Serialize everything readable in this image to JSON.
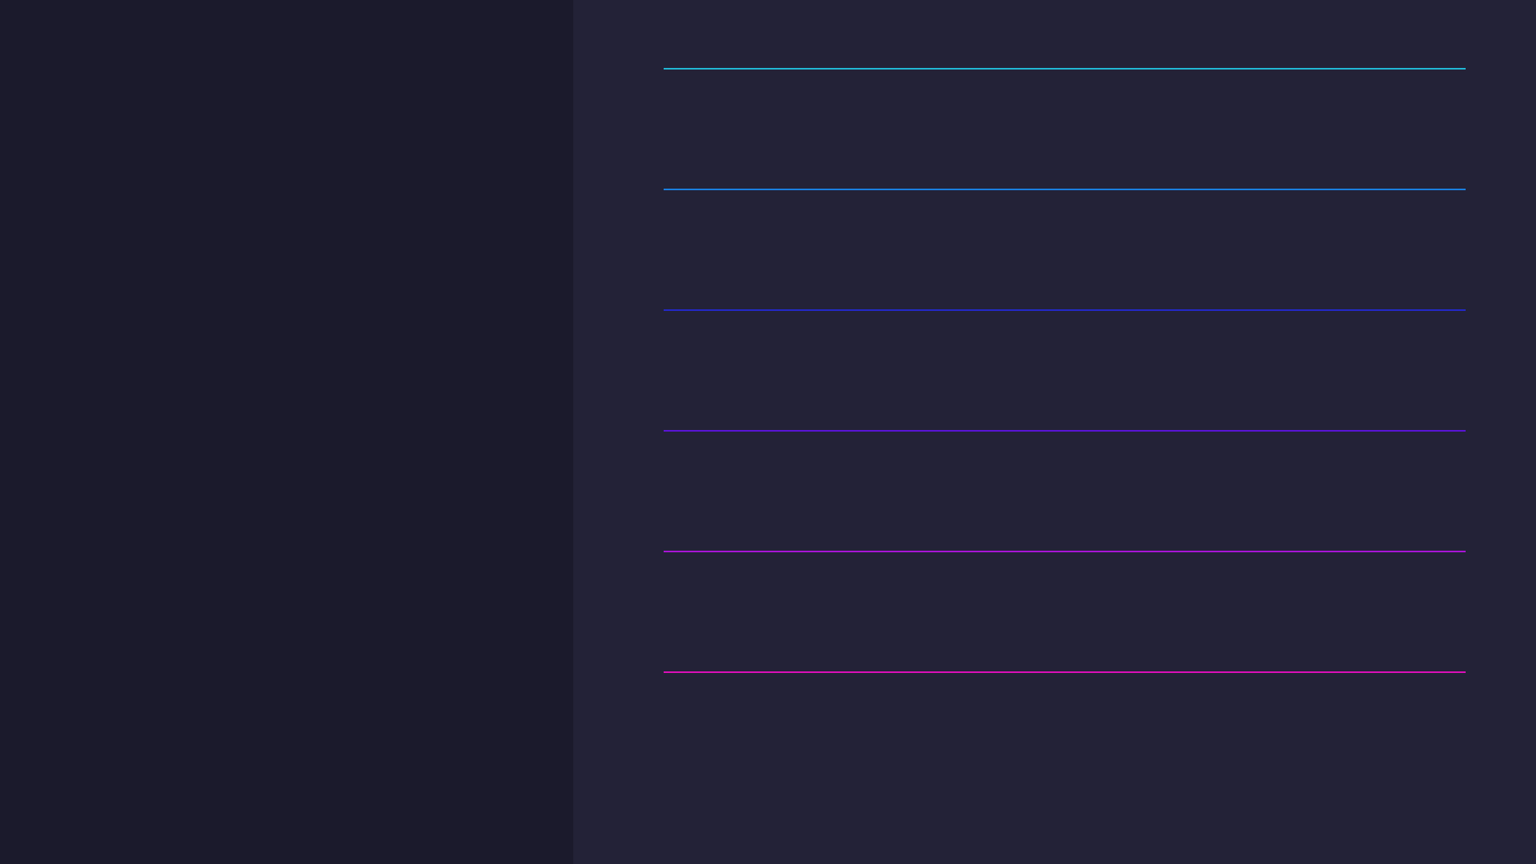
{
  "sidebar": {},
  "main": {
    "lines": [
      {
        "color": "#22b8d4"
      },
      {
        "color": "#1a7fe0"
      },
      {
        "color": "#2328c8"
      },
      {
        "color": "#5a14d6"
      },
      {
        "color": "#a815d6"
      },
      {
        "color": "#dd10b8"
      }
    ]
  }
}
